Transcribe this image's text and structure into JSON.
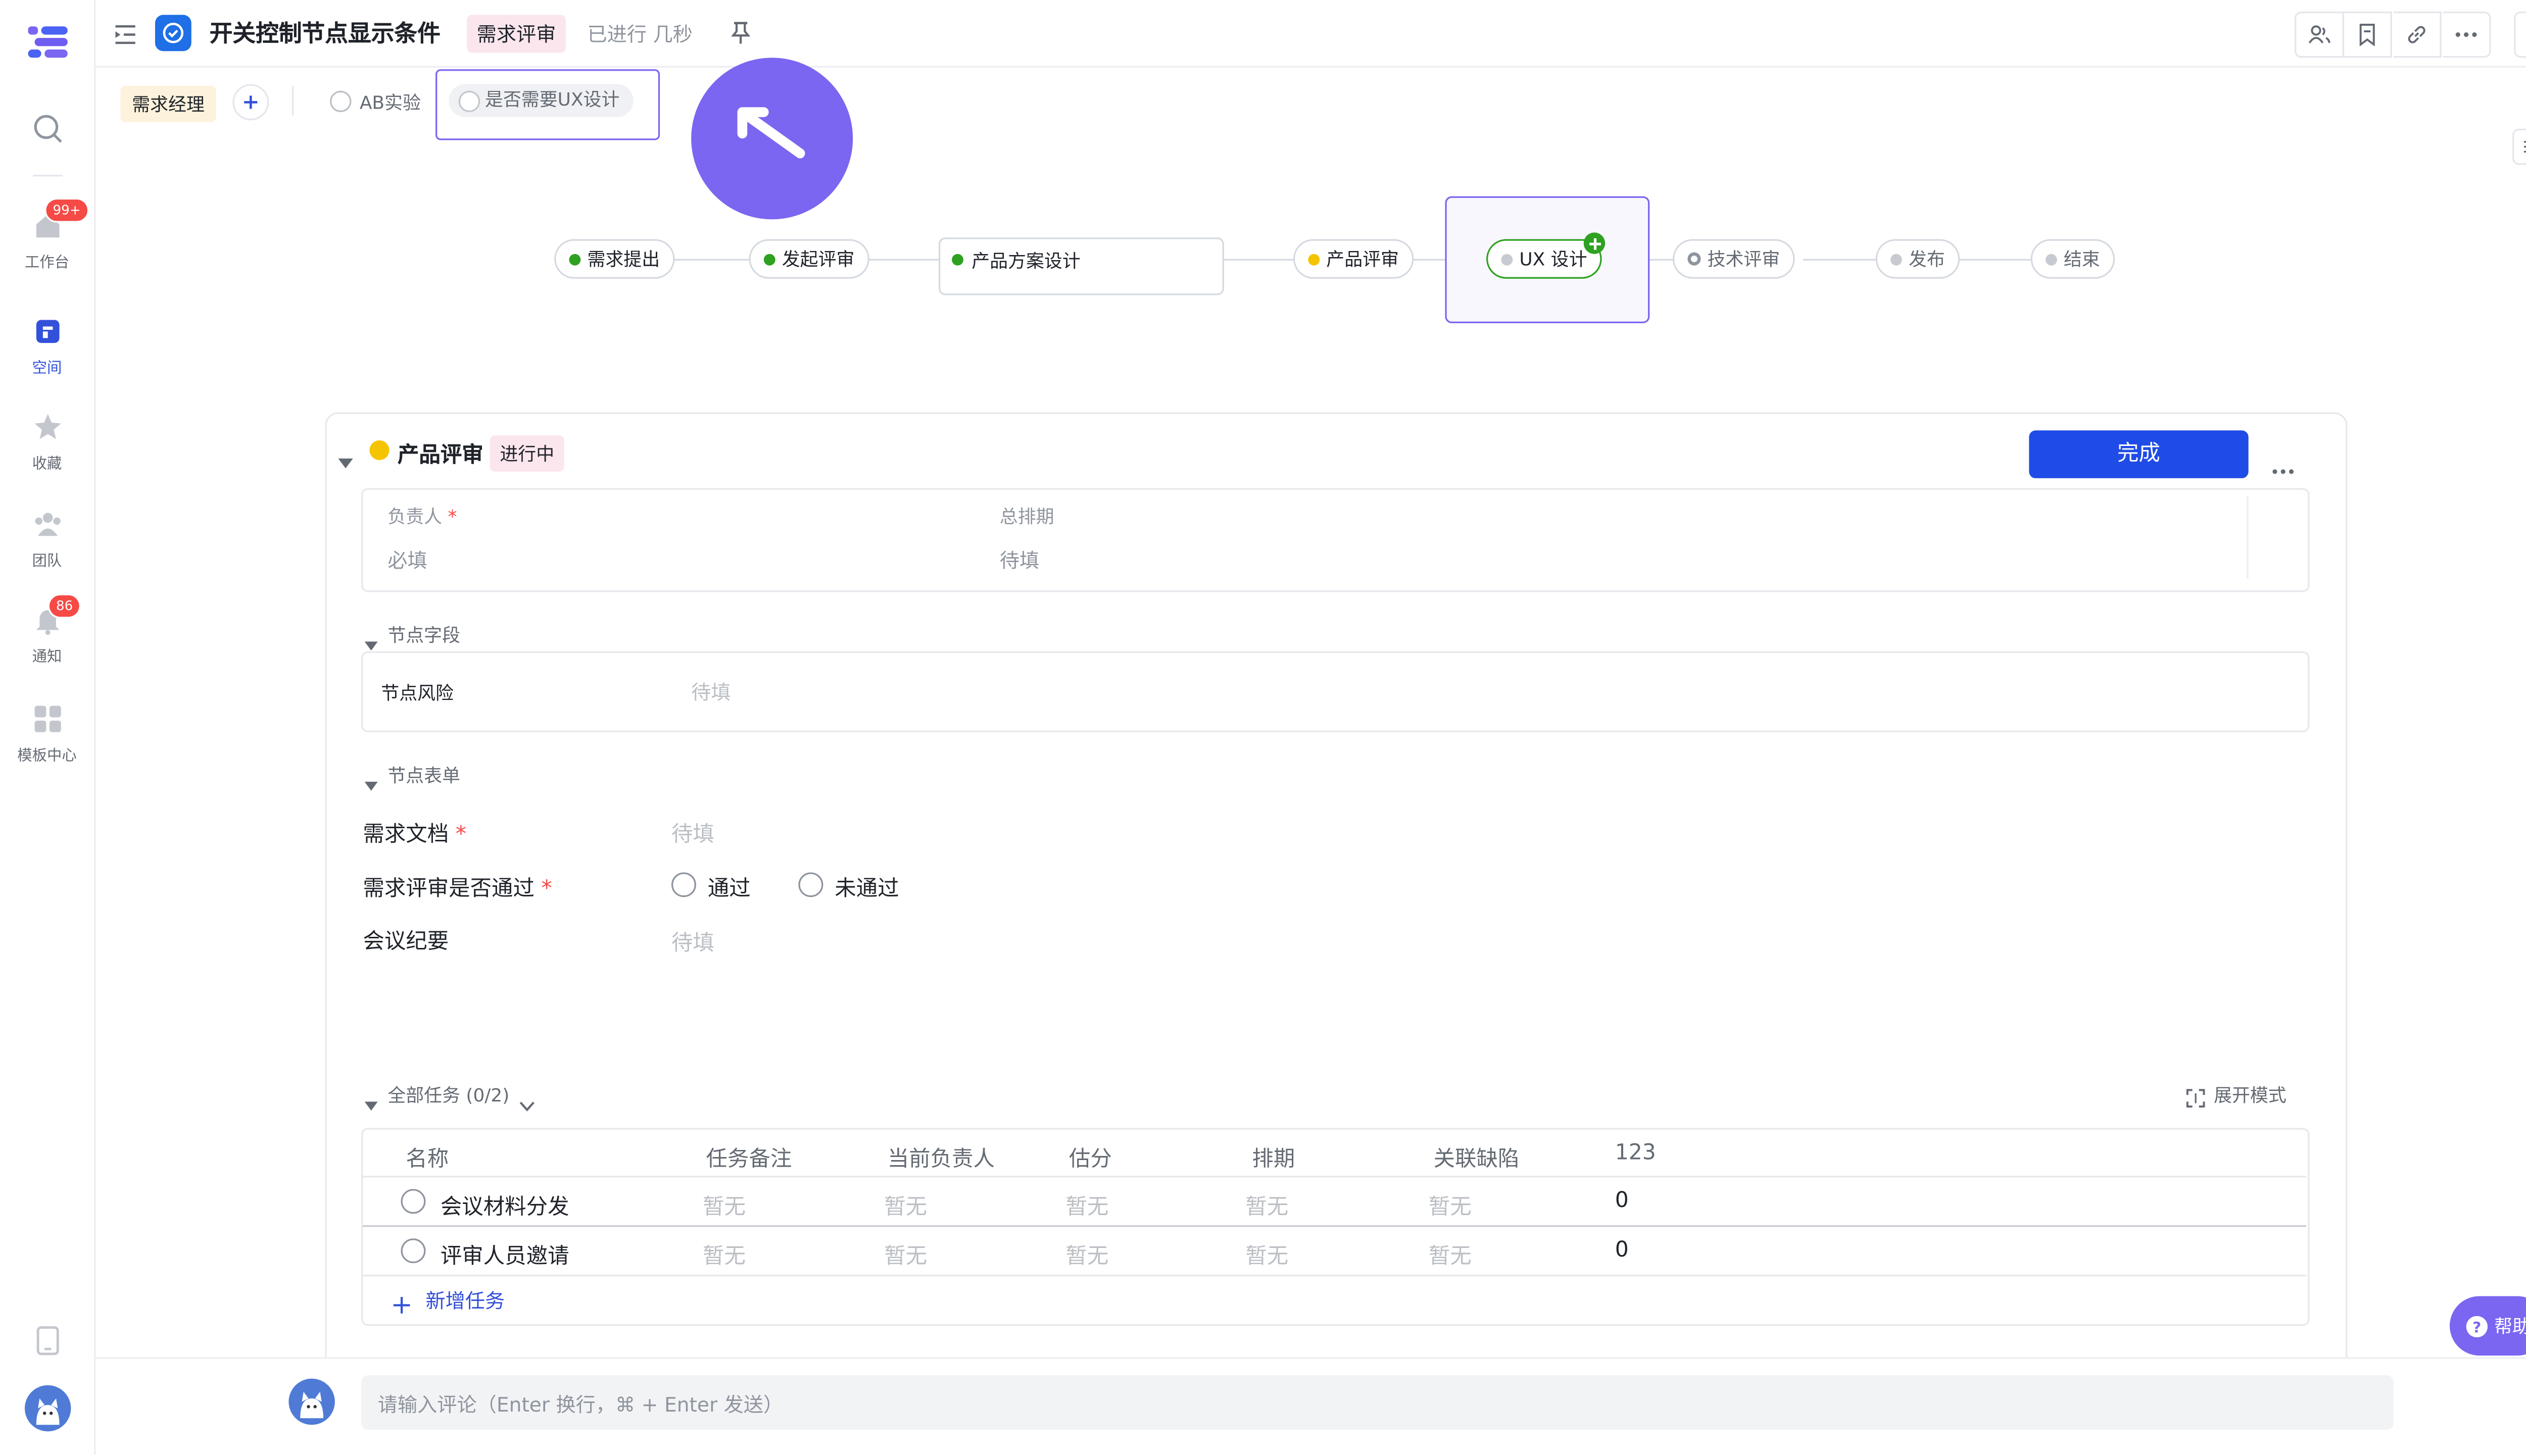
{
  "sidebar": {
    "items": [
      {
        "label": "工作台",
        "badge": "99+"
      },
      {
        "label": "空间"
      },
      {
        "label": "收藏"
      },
      {
        "label": "团队"
      },
      {
        "label": "通知",
        "badge": "86"
      },
      {
        "label": "模板中心"
      }
    ]
  },
  "header": {
    "title": "开关控制节点显示条件",
    "stage_tag": "需求评审",
    "elapsed": "已进行 几秒"
  },
  "roles": {
    "role_tag": "需求经理",
    "conditions": [
      "AB实验",
      "是否需要UX设计"
    ]
  },
  "flow": {
    "nodes": [
      {
        "label": "需求提出",
        "status": "done"
      },
      {
        "label": "发起评审",
        "status": "done"
      },
      {
        "label": "产品方案设计",
        "status": "done"
      },
      {
        "label": "产品评审",
        "status": "in-progress"
      },
      {
        "label": "UX 设计",
        "status": "pending"
      },
      {
        "label": "技术评审",
        "status": "pending"
      },
      {
        "label": "发布",
        "status": "pending"
      },
      {
        "label": "结束",
        "status": "pending"
      }
    ]
  },
  "node_panel": {
    "name": "产品评审",
    "status": "进行中",
    "complete_button": "完成",
    "owner_label": "负责人",
    "owner_value": "必填",
    "schedule_label": "总排期",
    "schedule_value": "待填",
    "fields_section": "节点字段",
    "risk_label": "节点风险",
    "risk_value": "待填",
    "form_section": "节点表单",
    "form": {
      "doc_label": "需求文档",
      "doc_value": "待填",
      "pass_label": "需求评审是否通过",
      "pass_option": "通过",
      "fail_option": "未通过",
      "minutes_label": "会议纪要",
      "minutes_value": "待填"
    }
  },
  "tasks": {
    "section_title": "全部任务 (0/2)",
    "expand_mode": "展开模式",
    "columns": [
      "名称",
      "任务备注",
      "当前负责人",
      "估分",
      "排期",
      "关联缺陷",
      "123"
    ],
    "rows": [
      {
        "name": "会议材料分发",
        "note": "暂无",
        "owner": "暂无",
        "points": "暂无",
        "schedule": "暂无",
        "defects": "暂无",
        "num": "0"
      },
      {
        "name": "评审人员邀请",
        "note": "暂无",
        "owner": "暂无",
        "points": "暂无",
        "schedule": "暂无",
        "defects": "暂无",
        "num": "0"
      }
    ],
    "add_task": "新增任务"
  },
  "comment": {
    "placeholder": "请输入评论（Enter 换行，⌘ + Enter 发送）"
  },
  "help": {
    "label": "帮助"
  },
  "colors": {
    "brand": "#3250d9",
    "done": "#2ea121",
    "in_progress": "#f5c400",
    "pending": "#c7cbd1",
    "cursor": "#7a66f0"
  }
}
